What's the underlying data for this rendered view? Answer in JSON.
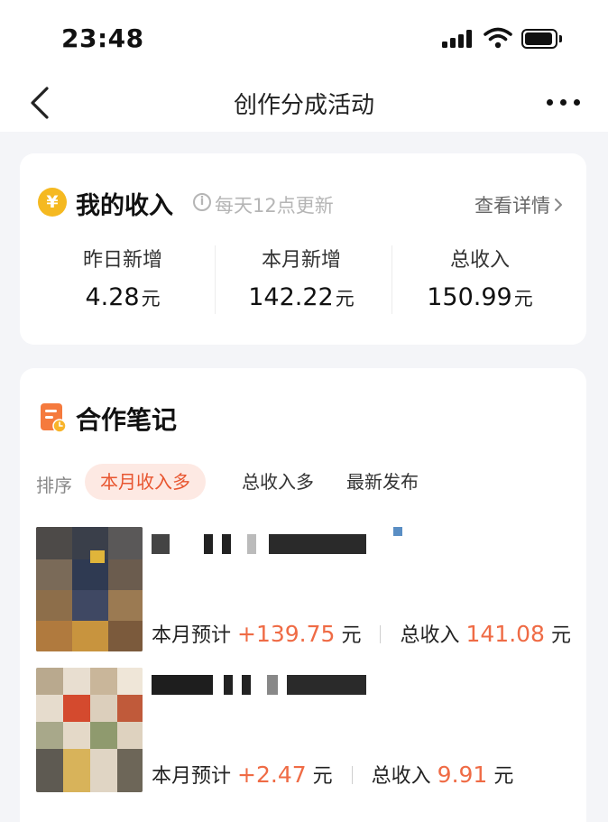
{
  "status_bar": {
    "time": "23:48",
    "icons": [
      "signal-icon",
      "wifi-icon",
      "battery-icon"
    ]
  },
  "nav": {
    "title": "创作分成活动",
    "icons": [
      "back-icon",
      "more-icon"
    ]
  },
  "income": {
    "icon": "coin-icon",
    "coin_glyph": "¥",
    "title": "我的收入",
    "info_glyph": "i",
    "update_hint": "每天12点更新",
    "detail_link": "查看详情",
    "stats": [
      {
        "label": "昨日新增",
        "value": "4.28",
        "unit": "元"
      },
      {
        "label": "本月新增",
        "value": "142.22",
        "unit": "元"
      },
      {
        "label": "总收入",
        "value": "150.99",
        "unit": "元"
      }
    ]
  },
  "notes": {
    "icon": "notes-icon",
    "title": "合作笔记",
    "sort_label": "排序",
    "sort_tabs": [
      "本月收入多",
      "总收入多",
      "最新发布"
    ],
    "items": [
      {
        "month_label": "本月预计",
        "month_value": "+139.75",
        "month_unit": "元",
        "total_label": "总收入",
        "total_value": "141.08",
        "total_unit": "元"
      },
      {
        "month_label": "本月预计",
        "month_value": "+2.47",
        "month_unit": "元",
        "total_label": "总收入",
        "total_value": "9.91",
        "total_unit": "元"
      }
    ]
  },
  "colors": {
    "accent": "#ef6b45",
    "coin": "#f5b921",
    "active_tab_bg": "#fde9e3"
  }
}
